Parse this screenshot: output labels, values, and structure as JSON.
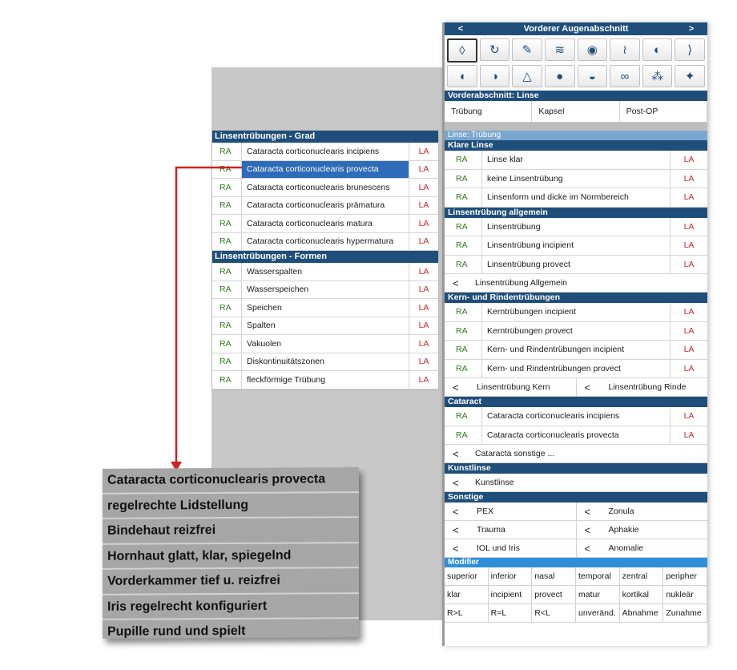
{
  "left": {
    "sections": [
      {
        "title": "Linsentrübungen - Grad",
        "rows": [
          {
            "ra": "RA",
            "text": "Cataracta corticonuclearis incipiens",
            "la": "LA",
            "selected": false
          },
          {
            "ra": "RA",
            "text": "Cataracta corticonuclearis provecta",
            "la": "LA",
            "selected": true
          },
          {
            "ra": "RA",
            "text": "Cataracta corticonuclearis brunescens",
            "la": "LA",
            "selected": false
          },
          {
            "ra": "RA",
            "text": "Cataracta corticonuclearis prämatura",
            "la": "LA",
            "selected": false
          },
          {
            "ra": "RA",
            "text": "Cataracta corticonuclearis matura",
            "la": "LA",
            "selected": false
          },
          {
            "ra": "RA",
            "text": "Cataracta corticonuclearis hypermatura",
            "la": "LA",
            "selected": false
          }
        ]
      },
      {
        "title": "Linsentrübungen - Formen",
        "rows": [
          {
            "ra": "RA",
            "text": "Wasserspalten",
            "la": "LA"
          },
          {
            "ra": "RA",
            "text": "Wasserspeichen",
            "la": "LA"
          },
          {
            "ra": "RA",
            "text": "Speichen",
            "la": "LA"
          },
          {
            "ra": "RA",
            "text": "Spalten",
            "la": "LA"
          },
          {
            "ra": "RA",
            "text": "Vakuolen",
            "la": "LA"
          },
          {
            "ra": "RA",
            "text": "Diskontinuitätszonen",
            "la": "LA"
          },
          {
            "ra": "RA",
            "text": "fleckförmige Trübung",
            "la": "LA"
          }
        ]
      }
    ]
  },
  "text_panel": {
    "lines": [
      "Cataracta corticonuclearis provecta",
      "regelrechte Lidstellung",
      "Bindehaut reizfrei",
      "Hornhaut glatt, klar, spiegelnd",
      "Vorderkammer tief u. reizfrei",
      "Iris regelrecht konfiguriert",
      "Pupille rund und spielt"
    ]
  },
  "right": {
    "nav_prev": "<",
    "nav_next": ">",
    "title": "Vorderer Augenabschnitt",
    "icons": [
      {
        "name": "lens-icon",
        "glyph": "◊"
      },
      {
        "name": "eye-rotation-icon",
        "glyph": "↻"
      },
      {
        "name": "eyelid-pen-icon",
        "glyph": "✎"
      },
      {
        "name": "eyelid-closed-icon",
        "glyph": "≋"
      },
      {
        "name": "eye-view-icon",
        "glyph": "◉"
      },
      {
        "name": "tear-duct-icon",
        "glyph": "≀"
      },
      {
        "name": "iris-arrow-icon",
        "glyph": "◐"
      },
      {
        "name": "cornea-arrow-icon",
        "glyph": "⟩"
      },
      {
        "name": "cornea-side-icon",
        "glyph": "◖"
      },
      {
        "name": "pupil-arrow-icon",
        "glyph": "◑"
      },
      {
        "name": "angle-icon",
        "glyph": "△"
      },
      {
        "name": "pupil-icon",
        "glyph": "●"
      },
      {
        "name": "iris-left-icon",
        "glyph": "◒"
      },
      {
        "name": "vessels-icon",
        "glyph": "∞"
      },
      {
        "name": "cells-icon",
        "glyph": "⁂"
      },
      {
        "name": "ribbon-icon",
        "glyph": "✦"
      }
    ],
    "subheader": "Vorderabschnitt: Linse",
    "tabs": [
      "Trübung",
      "Kapsel",
      "Post-OP"
    ],
    "linse_label": "Linse: Trübung",
    "groups": [
      {
        "title": "Klare Linse",
        "rows": [
          {
            "ra": "RA",
            "text": "Linse klar",
            "la": "LA"
          },
          {
            "ra": "RA",
            "text": "keine Linsentrübung",
            "la": "LA"
          },
          {
            "ra": "RA",
            "text": "Linsenform und dicke im Normbereich",
            "la": "LA"
          }
        ],
        "links": []
      },
      {
        "title": "Linsentrübung allgemein",
        "rows": [
          {
            "ra": "RA",
            "text": "Linsentrübung",
            "la": "LA"
          },
          {
            "ra": "RA",
            "text": "Linsentrübung incipient",
            "la": "LA"
          },
          {
            "ra": "RA",
            "text": "Linsentrübung provect",
            "la": "LA"
          }
        ],
        "links": [
          "Linsentrübung Allgemein"
        ]
      },
      {
        "title": "Kern- und Rindentrübungen",
        "rows": [
          {
            "ra": "RA",
            "text": "Kerntrübungen incipient",
            "la": "LA"
          },
          {
            "ra": "RA",
            "text": "Kerntrübungen provect",
            "la": "LA"
          },
          {
            "ra": "RA",
            "text": "Kern- und Rindentrübungen incipient",
            "la": "LA"
          },
          {
            "ra": "RA",
            "text": "Kern- und Rindentrübungen provect",
            "la": "LA"
          }
        ],
        "links2": [
          [
            "Linsentrübung Kern",
            "Linsentrübung Rinde"
          ]
        ]
      },
      {
        "title": "Cataract",
        "rows": [
          {
            "ra": "RA",
            "text": "Cataracta corticonuclearis incipiens",
            "la": "LA"
          },
          {
            "ra": "RA",
            "text": "Cataracta corticonuclearis provecta",
            "la": "LA"
          }
        ],
        "links": [
          "Cataracta sonstige ..."
        ]
      },
      {
        "title": "Kunstlinse",
        "rows": [],
        "links": [
          "Kunstlinse"
        ]
      },
      {
        "title": "Sonstige",
        "rows": [],
        "links2": [
          [
            "PEX",
            "Zonula"
          ],
          [
            "Trauma",
            "Aphakie"
          ],
          [
            "IOL und Iris",
            "Anomalie"
          ]
        ]
      }
    ],
    "chev": "<",
    "modifier_title": "Modifier",
    "modifiers": [
      "superior",
      "inferior",
      "nasal",
      "temporal",
      "zentral",
      "peripher",
      "klar",
      "incipient",
      "provect",
      "matur",
      "kortikal",
      "nukleär",
      "R>L",
      "R=L",
      "R<L",
      "unveränd.",
      "Abnahme",
      "Zunahme"
    ]
  }
}
